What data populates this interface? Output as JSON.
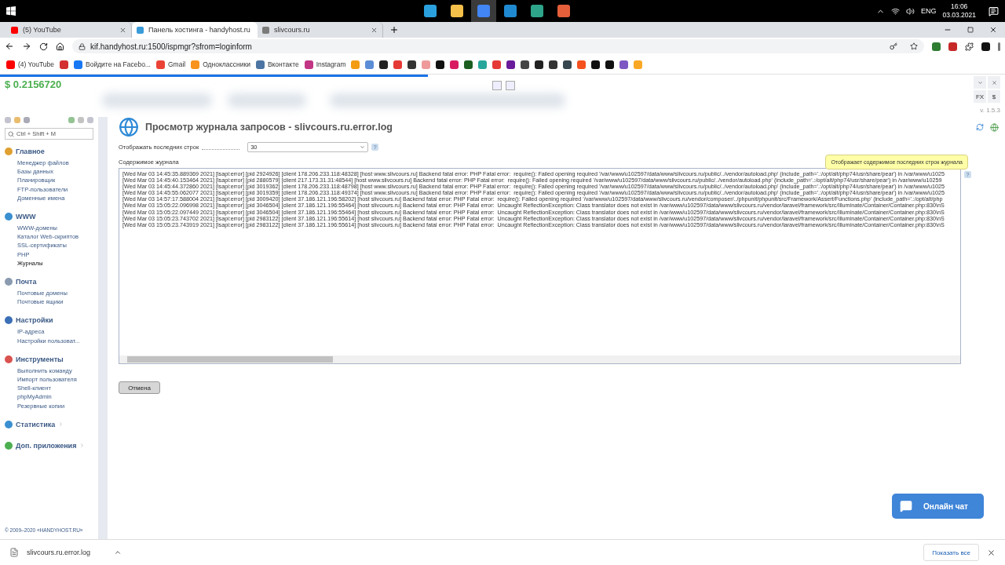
{
  "taskbar": {
    "apps": [
      {
        "selected": false
      },
      {
        "selected": false
      },
      {
        "selected": true
      },
      {
        "selected": false
      },
      {
        "selected": false
      },
      {
        "selected": false
      }
    ],
    "language": "ENG",
    "time": "16:06",
    "date": "03.03.2021"
  },
  "tabs": [
    {
      "label": "(5) YouTube",
      "selected": false,
      "color": "#ff0000"
    },
    {
      "label": "Панель хостинга - handyhost.ru",
      "selected": true,
      "color": "#3a9bd9"
    },
    {
      "label": "slivcours.ru",
      "selected": false,
      "color": "#7a7a7a"
    }
  ],
  "address": {
    "url": "kif.handyhost.ru:1500/ispmgr?sfrom=loginform"
  },
  "bookmarks": [
    {
      "label": "(4) YouTube",
      "color": "#ff0000"
    },
    {
      "color": "#d32f2f"
    },
    {
      "label": "Войдите на Facebo...",
      "color": "#1877f2"
    },
    {
      "label": "Gmail",
      "color": "#ea4335"
    },
    {
      "label": "Одноклассники",
      "color": "#f7931e"
    },
    {
      "label": "Вконтакте",
      "color": "#4c75a3"
    },
    {
      "label": "Instagram",
      "color": "#c13584"
    },
    {
      "color": "#f39c12"
    },
    {
      "color": "#5b8dd6"
    },
    {
      "color": "#222222"
    },
    {
      "color": "#e53935"
    },
    {
      "color": "#333333"
    },
    {
      "color": "#ef9a9a"
    },
    {
      "color": "#111111"
    },
    {
      "color": "#d81b60"
    },
    {
      "color": "#1b5e20"
    },
    {
      "color": "#26a69a"
    },
    {
      "color": "#e53935"
    },
    {
      "color": "#6a1b9a"
    },
    {
      "color": "#444444"
    },
    {
      "color": "#222222"
    },
    {
      "color": "#333333"
    },
    {
      "color": "#37474f"
    },
    {
      "color": "#f4511e"
    },
    {
      "color": "#111111"
    },
    {
      "color": "#111111"
    },
    {
      "color": "#7e57c2"
    },
    {
      "color": "#f9a825"
    }
  ],
  "page": {
    "balance": "$ 0.2156720",
    "version": "v. 1.5.3",
    "panel_buttons": [
      "FX",
      "$"
    ],
    "search": {
      "placeholder": "Ctrl + Shift + M"
    },
    "menu": [
      {
        "title": "Главное",
        "expanded": true,
        "color": "#e0a030",
        "items": [
          {
            "label": "Менеджер файлов",
            "selected": false
          },
          {
            "label": "Базы данных",
            "selected": false
          },
          {
            "label": "Планировщик",
            "selected": false
          },
          {
            "label": "FTP-пользователи",
            "selected": false
          },
          {
            "label": "Доменные имена",
            "selected": false
          }
        ]
      },
      {
        "title": "WWW",
        "expanded": true,
        "color": "#3a8fd0",
        "items": [
          {
            "label": "WWW-домены",
            "selected": false
          },
          {
            "label": "Каталог Web-скриптов",
            "selected": false
          },
          {
            "label": "SSL-сертификаты",
            "selected": false
          },
          {
            "label": "PHP",
            "selected": false
          },
          {
            "label": "Журналы",
            "selected": true
          }
        ]
      },
      {
        "title": "Почта",
        "expanded": true,
        "color": "#8a9bb0",
        "items": [
          {
            "label": "Почтовые домены",
            "selected": false
          },
          {
            "label": "Почтовые ящики",
            "selected": false
          }
        ]
      },
      {
        "title": "Настройки",
        "expanded": true,
        "color": "#3b6fb6",
        "items": [
          {
            "label": "IP-адреса",
            "selected": false
          },
          {
            "label": "Настройки пользоват...",
            "selected": false
          }
        ]
      },
      {
        "title": "Инструменты",
        "expanded": true,
        "color": "#d9534f",
        "items": [
          {
            "label": "Выполнить команду",
            "selected": false
          },
          {
            "label": "Импорт пользователя",
            "selected": false
          },
          {
            "label": "Shell-клиент",
            "selected": false
          },
          {
            "label": "phpMyAdmin",
            "selected": false
          },
          {
            "label": "Резервные копии",
            "selected": false
          }
        ]
      },
      {
        "title": "Статистика",
        "expanded": false,
        "color": "#3a8fd0"
      },
      {
        "title": "Доп. приложения",
        "expanded": false,
        "color": "#4caf50"
      }
    ],
    "copyright": "© 2009–2020 «HANDYHOST.RU»",
    "title": "Просмотр журнала запросов - slivcours.ru.error.log",
    "lines_label": "Отображать последних строк",
    "lines_value": "30",
    "help": "?",
    "tooltip": "Отображает содержимое последних строк журнала",
    "log_label": "Содержимое журнала",
    "log": [
      "[Wed Mar 03 14:45:35.889369 2021] [lsapi:error] [pid 2924926] [client 178.206.233.118:48328] [host www.slivcours.ru] Backend fatal error: PHP Fatal error:  require(): Failed opening required '/var/www/u102597/data/www/slivcours.ru/public/../vendor/autoload.php' (include_path='.:/opt/alt/php74/usr/share/pear') in /var/www/u1025",
      "[Wed Mar 03 14:45:40.153464 2021] [lsapi:error] [pid 2880579] [client 217.173.31.31:48544] [host www.slivcours.ru] Backend fatal error: PHP Fatal error:  require(): Failed opening required '/var/www/u102597/data/www/slivcours.ru/public/../vendor/autoload.php' (include_path='.:/opt/alt/php74/usr/share/pear') in /var/www/u10259",
      "[Wed Mar 03 14:45:44.372860 2021] [lsapi:error] [pid 3019362] [client 178.206.233.118:48798] [host www.slivcours.ru] Backend fatal error: PHP Fatal error:  require(): Failed opening required '/var/www/u102597/data/www/slivcours.ru/public/../vendor/autoload.php' (include_path='.:/opt/alt/php74/usr/share/pear') in /var/www/u1025",
      "[Wed Mar 03 14:45:55.062077 2021] [lsapi:error] [pid 3019359] [client 178.206.233.118:49374] [host www.slivcours.ru] Backend fatal error: PHP Fatal error:  require(): Failed opening required '/var/www/u102597/data/www/slivcours.ru/public/../vendor/autoload.php' (include_path='.:/opt/alt/php74/usr/share/pear') in /var/www/u1025",
      "[Wed Mar 03 14:57:17.588004 2021] [lsapi:error] [pid 3009420] [client 37.186.121.196:58202] [host slivcours.ru] Backend fatal error: PHP Fatal error:  require(): Failed opening required '/var/www/u102597/data/www/slivcours.ru/vendor/composer/../phpunit/phpunit/src/Framework/Assert/Functions.php' (include_path='.:/opt/alt/php",
      "[Wed Mar 03 15:05:22.096998 2021] [lsapi:error] [pid 3046504] [client 37.186.121.196:55464] [host slivcours.ru] Backend fatal error: PHP Fatal error:  Uncaught ReflectionException: Class translator does not exist in /var/www/u102597/data/www/slivcours.ru/vendor/laravel/framework/src/Illuminate/Container/Container.php:830\\nS",
      "[Wed Mar 03 15:05:22.097449 2021] [lsapi:error] [pid 3046504] [client 37.186.121.196:55464] [host slivcours.ru] Backend fatal error: PHP Fatal error:  Uncaught ReflectionException: Class translator does not exist in /var/www/u102597/data/www/slivcours.ru/vendor/laravel/framework/src/Illuminate/Container/Container.php:830\\nS",
      "[Wed Mar 03 15:05:23.743702 2021] [lsapi:error] [pid 2983122] [client 37.186.121.196:55614] [host slivcours.ru] Backend fatal error: PHP Fatal error:  Uncaught ReflectionException: Class translator does not exist in /var/www/u102597/data/www/slivcours.ru/vendor/laravel/framework/src/Illuminate/Container/Container.php:830\\nS",
      "[Wed Mar 03 15:05:23.743919 2021] [lsapi:error] [pid 2983122] [client 37.186.121.196:55614] [host slivcours.ru] Backend fatal error: PHP Fatal error:  Uncaught ReflectionException: Class translator does not exist in /var/www/u102597/data/www/slivcours.ru/vendor/laravel/framework/src/Illuminate/Container/Container.php:830\\nS"
    ],
    "cancel": "Отмена",
    "chat": "Онлайн чат"
  },
  "downloads": {
    "file": "slivcours.ru.error.log",
    "show_all": "Показать все"
  }
}
